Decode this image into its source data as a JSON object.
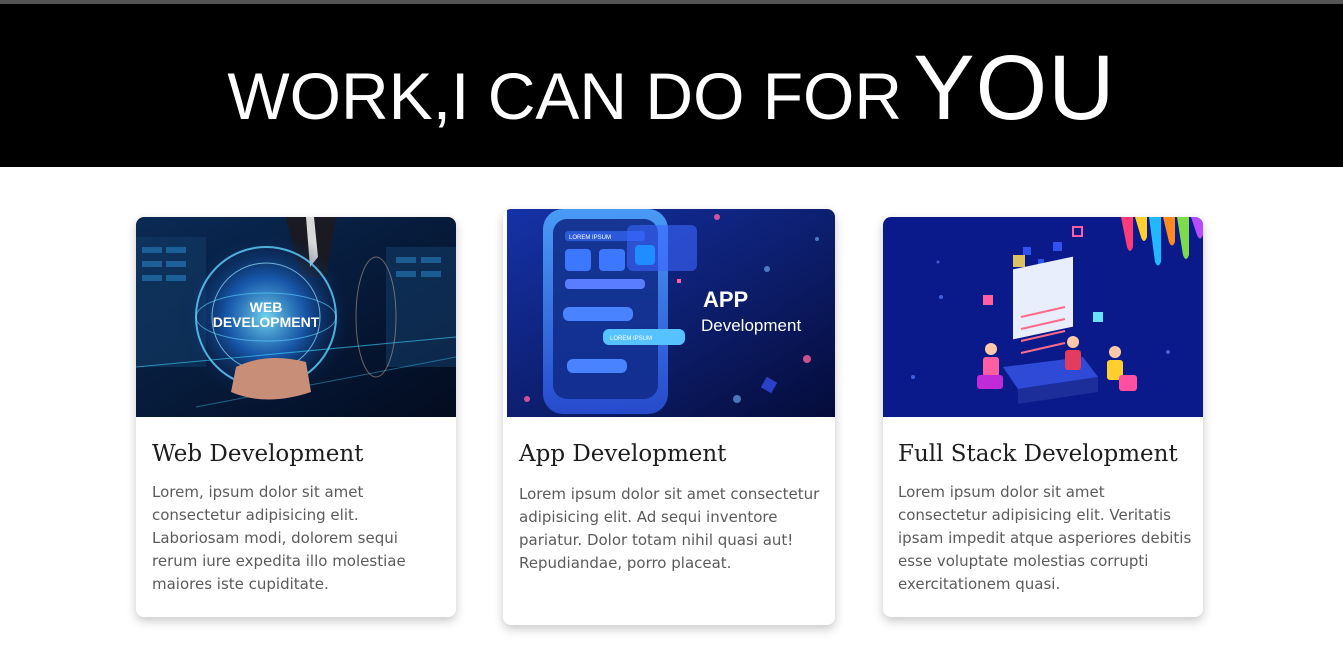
{
  "header": {
    "title_main": "WORK,I CAN DO FOR",
    "title_accent": "YOU"
  },
  "cards": [
    {
      "title": "Web Development",
      "image_text": [
        "WEB",
        "DEVELOPMENT"
      ],
      "body": "Lorem, ipsum dolor sit amet consectetur adipisicing elit. Laboriosam modi, dolorem sequi rerum iure expedita illo molestiae maiores iste cupiditate."
    },
    {
      "title": "App Development",
      "image_text": [
        "APP",
        "Development",
        "LOREM IPSUM",
        "LOREM IPSUM"
      ],
      "body": "Lorem ipsum dolor sit amet consectetur adipisicing elit. Ad sequi inventore pariatur. Dolor totam nihil quasi aut! Repudiandae, porro placeat."
    },
    {
      "title": "Full Stack Development",
      "body": "Lorem ipsum dolor sit amet consectetur adipisicing elit. Veritatis ipsam impedit atque asperiores debitis esse voluptate molestias corrupti exercitationem quasi."
    }
  ],
  "colors": {
    "header_bg": "#000000",
    "heading_text": "#1d1d1d",
    "body_text": "#5b5b5b",
    "image_navy": "#0a1a8a"
  }
}
